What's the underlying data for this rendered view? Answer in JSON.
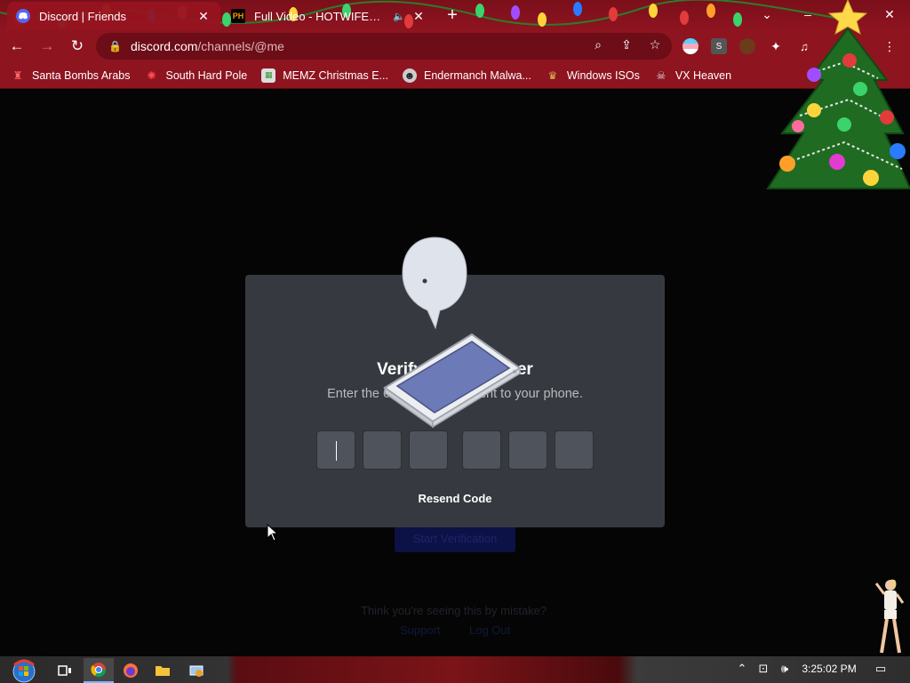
{
  "browser": {
    "tabs": [
      {
        "title": "Discord | Friends",
        "favicon": "discord-icon",
        "active": true
      },
      {
        "title": "Full Video - HOTWIFEXXX -",
        "favicon_text": "PH",
        "active": false
      }
    ],
    "new_tab_label": "+",
    "window_controls": {
      "search_tabs": "⌄",
      "minimize": "–",
      "maximize": "☐",
      "close": "✕"
    },
    "url": {
      "host": "discord.com",
      "path": "/channels/@me"
    },
    "bookmarks": [
      {
        "label": "Santa Bombs Arabs",
        "icon": "santa-icon"
      },
      {
        "label": "South Hard Pole",
        "icon": "snowflake-icon"
      },
      {
        "label": "MEMZ Christmas E...",
        "icon": "memz-icon"
      },
      {
        "label": "Endermanch Malwa...",
        "icon": "enderman-icon"
      },
      {
        "label": "Windows ISOs",
        "icon": "windows-iso-icon"
      },
      {
        "label": "VX Heaven",
        "icon": "vx-heaven-icon"
      }
    ],
    "extension_letter": "S"
  },
  "modal": {
    "title": "Verify Your Number",
    "subtitle": "Enter the 6 digit code we sent to your phone.",
    "code_length": 6,
    "resend_label": "Resend Code"
  },
  "background_page": {
    "start_button": "Start Verification",
    "mistake_text": "Think you're seeing this by mistake?",
    "support_link": "Support",
    "logout_link": "Log Out"
  },
  "taskbar": {
    "clock": "3:25:02 PM",
    "apps": [
      "start-orb-icon",
      "task-view-icon",
      "chrome-icon",
      "firefox-icon",
      "file-explorer-icon",
      "control-panel-icon"
    ]
  },
  "colors": {
    "chrome_frame": "#8e1420",
    "modal_bg": "#36393f",
    "code_box": "#4f545c"
  }
}
